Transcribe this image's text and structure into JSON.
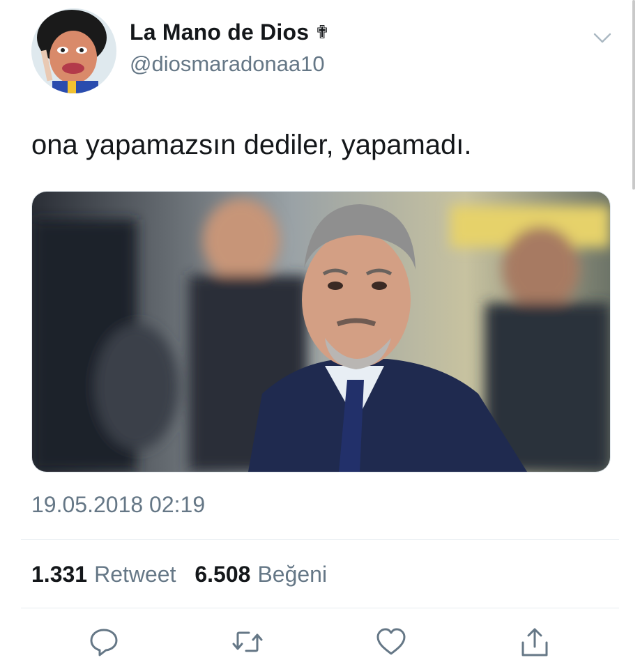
{
  "tweet": {
    "display_name": "La Mano de Dios",
    "name_badge": "✟",
    "handle": "@diosmaradonaa10",
    "text": "ona yapamazsın dediler, yapamadı.",
    "timestamp": "19.05.2018 02:19"
  },
  "stats": {
    "retweets_count": "1.331",
    "retweets_label": "Retweet",
    "likes_count": "6.508",
    "likes_label": "Beğeni"
  },
  "actions": [
    {
      "name": "reply",
      "icon": "reply-bubble-icon"
    },
    {
      "name": "retweet",
      "icon": "retweet-arrows-icon"
    },
    {
      "name": "like",
      "icon": "heart-icon"
    },
    {
      "name": "share",
      "icon": "share-upload-icon"
    }
  ],
  "colors": {
    "text_primary": "#14171a",
    "text_secondary": "#657786",
    "icon": "#657786",
    "divider": "#e6ecf0",
    "background": "#ffffff"
  }
}
